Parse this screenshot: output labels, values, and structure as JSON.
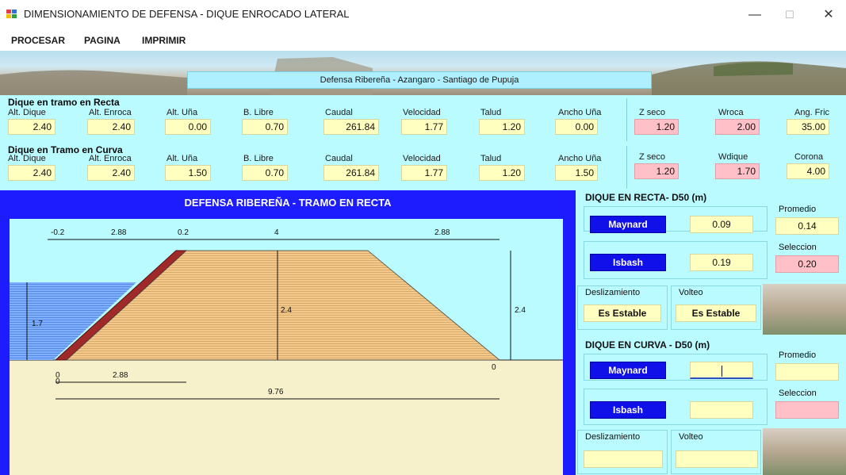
{
  "window": {
    "title": "DIMENSIONAMIENTO DE DEFENSA - DIQUE ENROCADO LATERAL",
    "minimize": "—",
    "maximize": "☐",
    "close": "✕"
  },
  "menu": {
    "items": [
      "PROCESAR",
      "PAGINA",
      "IMPRIMIR"
    ]
  },
  "banner": {
    "title": "Defensa Ribereña - Azangaro - Santiago de Pupuja"
  },
  "recta": {
    "title": "Dique en tramo en Recta",
    "fields": [
      {
        "label": "Alt. Dique",
        "value": "2.40"
      },
      {
        "label": "Alt. Enroca",
        "value": "2.40"
      },
      {
        "label": "Alt. Uña",
        "value": "0.00"
      },
      {
        "label": "B. Libre",
        "value": "0.70"
      },
      {
        "label": "Caudal",
        "value": "261.84"
      },
      {
        "label": "Velocidad",
        "value": "1.77"
      },
      {
        "label": "Talud",
        "value": "1.20"
      },
      {
        "label": "Ancho Uña",
        "value": "0.00"
      },
      {
        "label": "Z seco",
        "value": "1.20"
      },
      {
        "label": "Wroca",
        "value": "2.00"
      },
      {
        "label": "Ang. Fric",
        "value": "35.00"
      }
    ]
  },
  "curva": {
    "title": "Dique en Tramo en Curva",
    "fields": [
      {
        "label": "Alt. Dique",
        "value": "2.40"
      },
      {
        "label": "Alt. Enroca",
        "value": "2.40"
      },
      {
        "label": "Alt. Uña",
        "value": "1.50"
      },
      {
        "label": "B. Libre",
        "value": "0.70"
      },
      {
        "label": "Caudal",
        "value": "261.84"
      },
      {
        "label": "Velocidad",
        "value": "1.77"
      },
      {
        "label": "Talud",
        "value": "1.20"
      },
      {
        "label": "Ancho Uña",
        "value": "1.50"
      },
      {
        "label": "Z seco",
        "value": "1.20"
      },
      {
        "label": "Wdique",
        "value": "1.70"
      },
      {
        "label": "Corona",
        "value": "4.00"
      }
    ]
  },
  "drawing": {
    "title": "DEFENSA RIBEREÑA - TRAMO EN RECTA",
    "dims": {
      "top_a": "-0.2",
      "top_b": "2.88",
      "top_c": "0.2",
      "top_d": "4",
      "top_e": "2.88",
      "h_water": "1.7",
      "h_mid": "2.4",
      "h_right": "2.4",
      "zero_right": "0",
      "bottom_zero_a": "0",
      "bottom_zero_b": "0",
      "bottom_a": "2.88",
      "bottom_total": "9.76"
    }
  },
  "right": {
    "recta_head": "DIQUE EN RECTA- D50 (m)",
    "curva_head": "DIQUE EN CURVA - D50 (m)",
    "maynard": "Maynard",
    "isbash": "Isbash",
    "promedio": "Promedio",
    "seleccion": "Seleccion",
    "recta_maynard_val": "0.09",
    "recta_isbash_val": "0.19",
    "recta_promedio_val": "0.14",
    "recta_seleccion_val": "0.20",
    "desliz": "Deslizamiento",
    "volteo": "Volteo",
    "es_estable": "Es Estable",
    "colors": {
      "yellow": "#ffffc0",
      "pink": "#ffc0c8",
      "blue": "#1010e8",
      "cyan": "#b9fbff"
    }
  }
}
